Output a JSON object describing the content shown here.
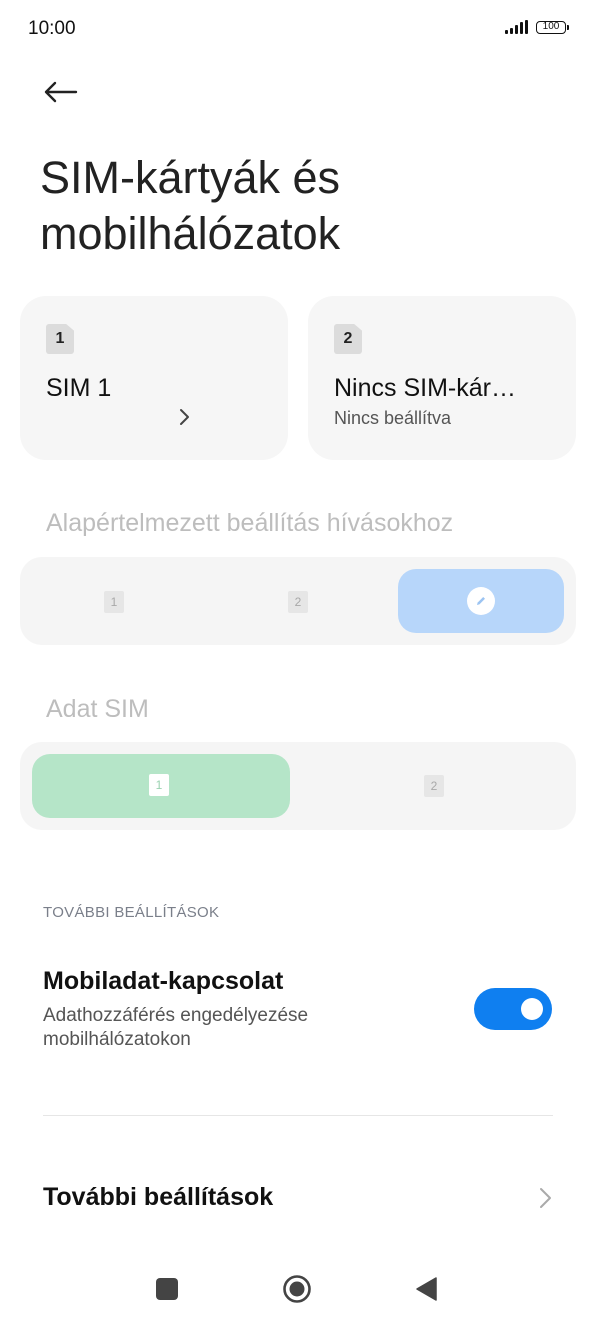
{
  "status_bar": {
    "time": "10:00",
    "battery": "100"
  },
  "page": {
    "title": "SIM-kártyák és mobilhálózatok"
  },
  "sim_cards": [
    {
      "badge": "1",
      "title": "SIM 1",
      "subtitle": ""
    },
    {
      "badge": "2",
      "title": "Nincs SIM-kár…",
      "subtitle": "Nincs beállítva"
    }
  ],
  "calls_section": {
    "label": "Alapértelmezett beállítás hívásokhoz",
    "options": [
      "1",
      "2"
    ],
    "selected_color": "#b7d6fa"
  },
  "data_section": {
    "label": "Adat SIM",
    "options": [
      "1",
      "2"
    ],
    "selected_color": "#b5e5c8"
  },
  "more_settings_header": "TOVÁBBI BEÁLLÍTÁSOK",
  "mobile_data": {
    "title": "Mobiladat-kapcsolat",
    "subtitle": "Adathozzáférés engedélyezése mobilhálózatokon",
    "enabled": true,
    "accent": "#0f7ff0"
  },
  "more_settings": {
    "title": "További beállítások"
  },
  "icons": [
    "back-arrow-icon",
    "chevron-right-icon",
    "pencil-icon",
    "signal-icon",
    "battery-icon"
  ]
}
